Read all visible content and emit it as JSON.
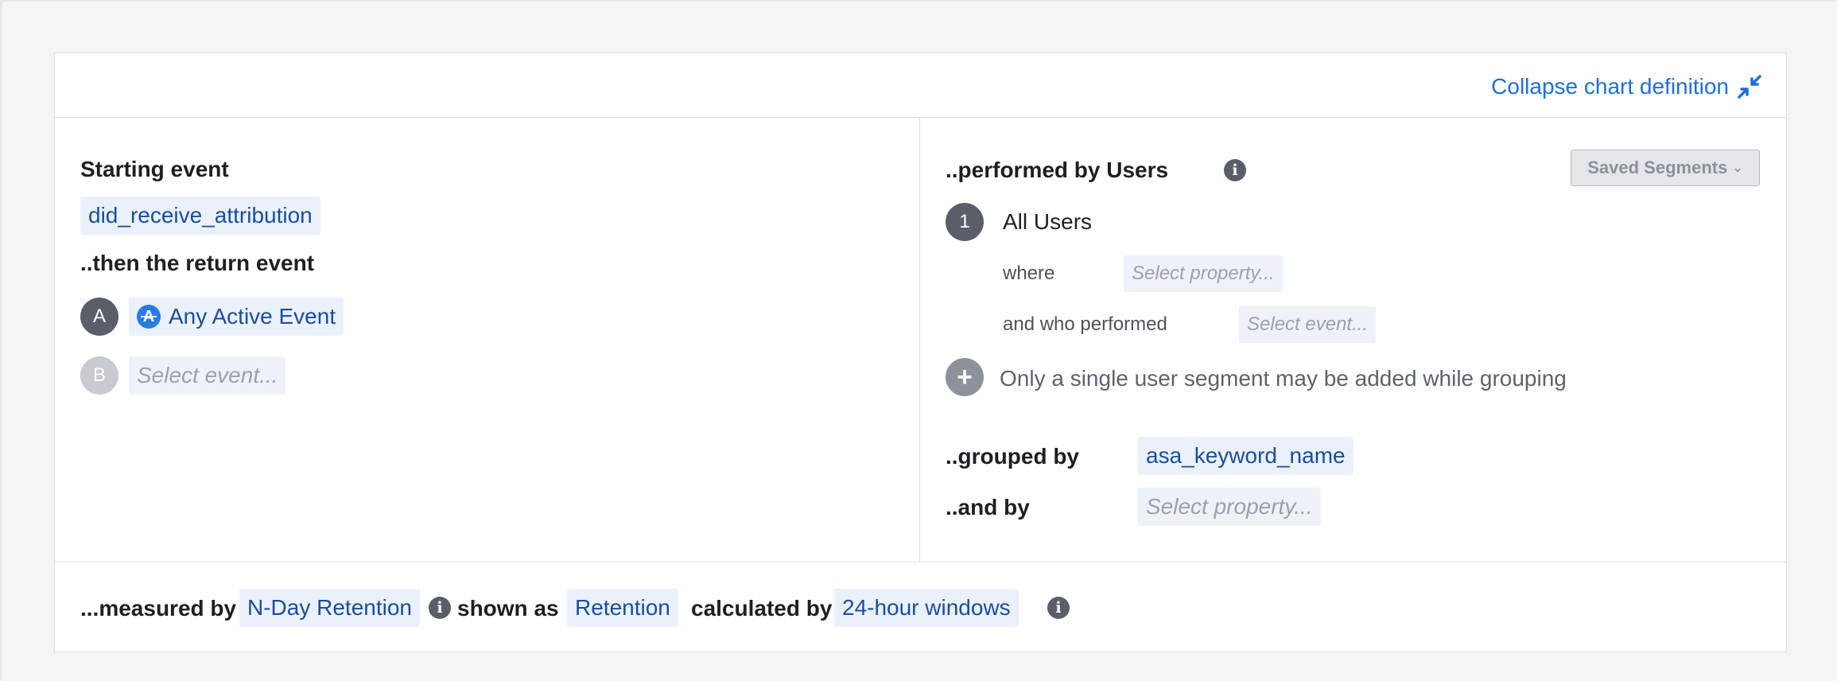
{
  "header": {
    "collapse_label": "Collapse chart definition",
    "collapse_icon": "collapse-arrows-icon"
  },
  "left": {
    "starting_event_label": "Starting event",
    "starting_event_value": "did_receive_attribution",
    "return_event_label": "..then the return event",
    "events": [
      {
        "badge": "A",
        "label": "Any Active Event",
        "icon": "any-active-event-icon"
      },
      {
        "badge": "B",
        "placeholder": "Select event..."
      }
    ]
  },
  "right": {
    "performed_by_label": "..performed by Users",
    "saved_segments_label": "Saved Segments",
    "segment": {
      "number": "1",
      "name": "All Users",
      "where_label": "where",
      "where_placeholder": "Select property...",
      "who_performed_label": "and who performed",
      "who_performed_placeholder": "Select event..."
    },
    "add_segment_note": "Only a single user segment may be added while grouping",
    "grouped_by_label": "..grouped by",
    "grouped_by_value": "asa_keyword_name",
    "and_by_label": "..and by",
    "and_by_placeholder": "Select property..."
  },
  "footer": {
    "measured_by_label": "...measured by",
    "measured_by_value": "N-Day Retention",
    "shown_as_label": "shown as",
    "shown_as_value": "Retention",
    "calculated_by_label": "calculated by",
    "calculated_by_value": "24-hour windows"
  },
  "colors": {
    "accent": "#1d6fd8",
    "chip_bg": "#eaf1fb",
    "chip_text": "#1b4d9c",
    "badge_dark": "#5a5e69"
  }
}
